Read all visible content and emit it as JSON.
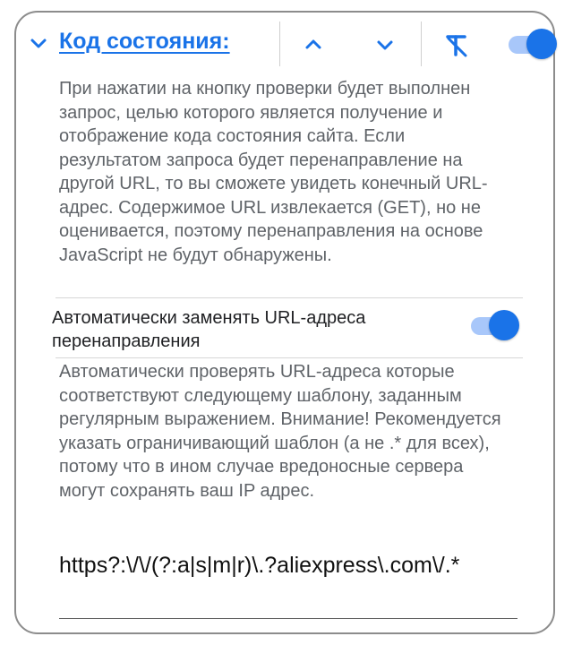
{
  "section": {
    "title": "Код состояния:",
    "description": "При нажатии на кнопку проверки будет выполнен запрос, целью которого является получение и отображение кода состояния сайта. Если результатом запроса будет перенаправление на другой URL, то вы сможете увидеть конечный URL-адрес. Содержимое URL извлекается (GET), но не оценивается, поэтому перенаправления на основе JavaScript не будут обнаружены.",
    "enabled": true
  },
  "auto_replace": {
    "label": "Автоматически заменять URL-адреса перенаправления",
    "enabled": true,
    "description": "Автоматически проверять URL-адреса которые соответствуют следующему шаблону, заданным регулярным выражением. Внимание! Рекомендуется указать ограничивающий шаблон (а не .* для всех), потому что в ином случае вредоносные сервера могут сохранять ваш IP адрес.",
    "pattern": "https?:\\/\\/(?:a|s|m|r)\\.?aliexpress\\.com\\/.*"
  },
  "icons": {
    "collapse": "chevron-down-icon",
    "move_up": "chevron-up-icon",
    "move_down": "chevron-down-icon",
    "clear_format": "clear-format-icon"
  },
  "colors": {
    "accent": "#1a73e8",
    "toggle_track": "#a8c7fa",
    "description_text": "#5f6368",
    "border": "#8c8c8c"
  }
}
